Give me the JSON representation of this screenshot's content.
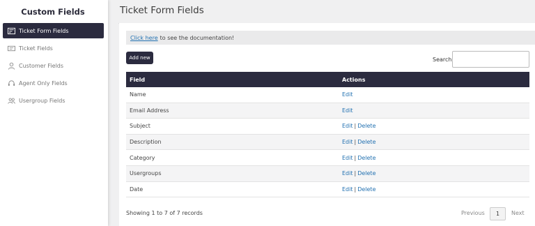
{
  "sidebar": {
    "title": "Custom Fields",
    "items": [
      {
        "label": "Ticket Form Fields",
        "icon": "form-icon",
        "active": true
      },
      {
        "label": "Ticket Fields",
        "icon": "ticket-icon",
        "active": false
      },
      {
        "label": "Customer Fields",
        "icon": "user-icon",
        "active": false
      },
      {
        "label": "Agent Only Fields",
        "icon": "headset-icon",
        "active": false
      },
      {
        "label": "Usergroup Fields",
        "icon": "users-icon",
        "active": false
      }
    ]
  },
  "header": {
    "title": "Ticket Form Fields"
  },
  "doc": {
    "link": "Click here",
    "text": "to see the documentation!"
  },
  "toolbar": {
    "add_label": "Add new",
    "search_label": "Search:",
    "search_value": ""
  },
  "table": {
    "headers": {
      "field": "Field",
      "actions": "Actions"
    },
    "rows": [
      {
        "field": "Name",
        "edit": "Edit",
        "delete": null
      },
      {
        "field": "Email Address",
        "edit": "Edit",
        "delete": null
      },
      {
        "field": "Subject",
        "edit": "Edit",
        "delete": "Delete"
      },
      {
        "field": "Description",
        "edit": "Edit",
        "delete": "Delete"
      },
      {
        "field": "Category",
        "edit": "Edit",
        "delete": "Delete"
      },
      {
        "field": "Usergroups",
        "edit": "Edit",
        "delete": "Delete"
      },
      {
        "field": "Date",
        "edit": "Edit",
        "delete": "Delete"
      }
    ]
  },
  "footer": {
    "info": "Showing 1 to 7 of 7 records",
    "previous": "Previous",
    "page": "1",
    "next": "Next"
  },
  "colors": {
    "accent": "#2b2b3f",
    "link": "#2271b1"
  }
}
